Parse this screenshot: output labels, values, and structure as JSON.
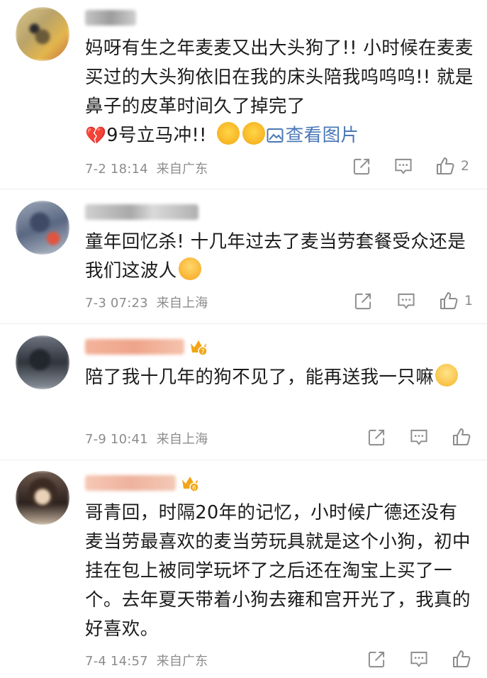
{
  "comments": [
    {
      "text": "妈呀有生之年麦麦又出大头狗了!! 小时候在麦麦买过的大头狗依旧在我的床头陪我呜呜呜!! 就是鼻子的皮革时间久了掉完了",
      "text_tail": "9号立马冲!!",
      "link": "查看图片",
      "time": "7-2 18:14",
      "source": "来自广东",
      "likes": "2"
    },
    {
      "text": "童年回忆杀! 十几年过去了麦当劳套餐受众还是我们这波人",
      "time": "7-3 07:23",
      "source": "来自上海",
      "likes": "1"
    },
    {
      "text": "陪了我十几年的狗不见了，能再送我一只嘛",
      "time": "7-9 10:41",
      "source": "来自上海",
      "likes": "",
      "badge": "7"
    },
    {
      "text": "哥青回，时隔20年的记忆，小时候广德还没有麦当劳最喜欢的麦当劳玩具就是这个小狗，初中挂在包上被同学玩坏了之后还在淘宝上买了一个。去年夏天带着小狗去雍和宫开光了，我真的好喜欢。",
      "time": "7-4 14:57",
      "source": "来自广东",
      "likes": "",
      "badge": "6"
    }
  ],
  "icons": {
    "share": "share-icon",
    "reply": "comment-icon",
    "like": "thumbs-up-icon",
    "heart": "broken-heart-emoji",
    "image": "picture-icon",
    "crown": "vip-crown-icon"
  },
  "colors": {
    "text": "#1b1b1b",
    "meta": "#8c8c8c",
    "link": "#4a78b7",
    "heart": "#d81e2f",
    "crown": "#f2a516"
  }
}
